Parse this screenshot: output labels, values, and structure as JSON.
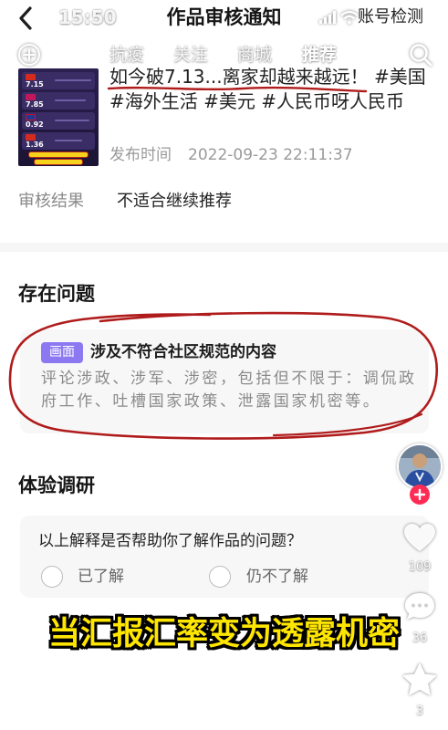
{
  "status_bar": {
    "time": "15:50",
    "signal_icon": "signal-icon",
    "wifi_icon": "wifi-icon"
  },
  "header": {
    "back_icon": "chevron-left-icon",
    "title": "作品审核通知",
    "account_check_label": "账号检测"
  },
  "overlay_nav": {
    "add_icon": "plus-circle-icon",
    "tabs": [
      {
        "label": "抗疫",
        "active": false
      },
      {
        "label": "关注",
        "active": false
      },
      {
        "label": "商城",
        "active": false
      },
      {
        "label": "推荐",
        "active": true
      }
    ],
    "search_icon": "search-icon"
  },
  "video": {
    "thumbnail": {
      "rates": [
        "7.15",
        "7.85",
        "0.92",
        "1.36"
      ]
    },
    "title": "如今破7.13...离家却越来越远！",
    "hashtags": [
      "#美国",
      "#海外生活",
      "#美元",
      "#人民币呀人民币"
    ],
    "publish_label": "发布时间",
    "publish_time": "2022-09-23 22:11:37"
  },
  "review": {
    "label": "审核结果",
    "value": "不适合继续推荐"
  },
  "issues": {
    "heading": "存在问题",
    "items": [
      {
        "tag": "画面",
        "title": "涉及不符合社区规范的内容",
        "description": "评论涉政、涉军、涉密，包括但不限于：调侃政府工作、吐槽国家政策、泄露国家机密等。"
      }
    ]
  },
  "survey": {
    "heading": "体验调研",
    "question": "以上解释是否帮助你了解作品的问题？",
    "options": [
      {
        "label": "已了解",
        "selected": false
      },
      {
        "label": "仍不了解",
        "selected": false
      }
    ]
  },
  "side_actions": {
    "avatar_icon": "avatar",
    "follow_icon": "plus-icon",
    "like": {
      "icon": "heart-icon",
      "count": "109"
    },
    "comment": {
      "icon": "comment-icon",
      "count": "36"
    },
    "favorite": {
      "icon": "star-icon",
      "count": "3"
    }
  },
  "caption": "当汇报汇率变为透露机密",
  "colors": {
    "annotation_red": "#b01c1c",
    "issue_tag": "#8c78f0",
    "follow": "#fe2c55",
    "caption_fill": "#ffe600"
  }
}
